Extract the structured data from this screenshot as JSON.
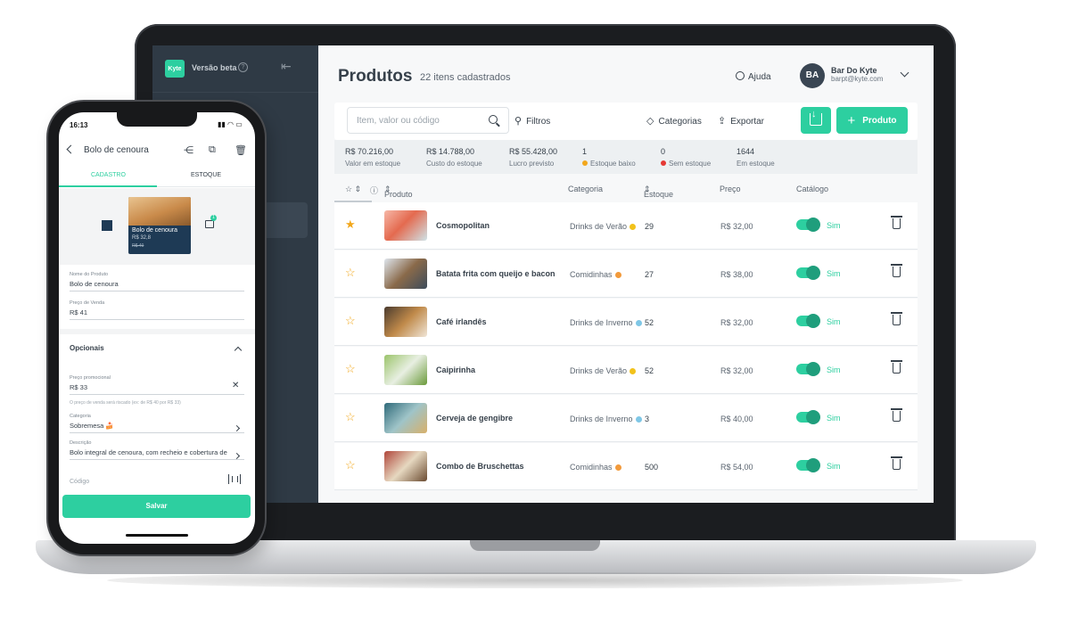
{
  "sidebar": {
    "logo": "Kyte",
    "beta_label": "Versão beta"
  },
  "header": {
    "title": "Produtos",
    "subtitle": "22 itens cadastrados",
    "help": "Ajuda",
    "account": {
      "initials": "BA",
      "name": "Bar Do Kyte",
      "email": "barpt@kyte.com"
    }
  },
  "toolbar": {
    "search_placeholder": "Item, valor ou código",
    "filters": "Filtros",
    "categories": "Categorias",
    "export": "Exportar",
    "add_product": "Produto"
  },
  "stats": [
    {
      "value": "R$ 70.216,00",
      "label": "Valor em estoque"
    },
    {
      "value": "R$ 14.788,00",
      "label": "Custo do estoque"
    },
    {
      "value": "R$ 55.428,00",
      "label": "Lucro previsto"
    },
    {
      "value": "1",
      "label": "Estoque baixo",
      "dot": "#f2a71b"
    },
    {
      "value": "0",
      "label": "Sem estoque",
      "dot": "#e53935"
    },
    {
      "value": "1644",
      "label": "Em estoque"
    }
  ],
  "table": {
    "columns": {
      "product": "Produto",
      "category": "Categoria",
      "stock": "Estoque",
      "price": "Preço",
      "catalog": "Catálogo"
    },
    "rows": [
      {
        "starred": true,
        "name": "Cosmopolitan",
        "category": "Drinks de Verão",
        "cat_dot": "#f2c21b",
        "stock": "29",
        "price": "R$ 32,00",
        "catalog": "Sim",
        "thumb": "linear-gradient(135deg,#f6b8a8,#e46a4f 45%,#cfe3e8)"
      },
      {
        "starred": false,
        "name": "Batata frita com queijo e bacon",
        "category": "Comidinhas",
        "cat_dot": "#f29a3b",
        "stock": "27",
        "price": "R$ 38,00",
        "catalog": "Sim",
        "thumb": "linear-gradient(135deg,#dfe6ee,#8a6a4a 50%,#3d4c5b)"
      },
      {
        "starred": false,
        "name": "Café irlandês",
        "category": "Drinks de Inverno",
        "cat_dot": "#7fc7e6",
        "stock": "52",
        "price": "R$ 32,00",
        "catalog": "Sim",
        "thumb": "linear-gradient(135deg,#4a3b2e,#c08a4a 50%,#f0e6d8)"
      },
      {
        "starred": false,
        "name": "Caipirinha",
        "category": "Drinks de Verão",
        "cat_dot": "#f2c21b",
        "stock": "52",
        "price": "R$ 32,00",
        "catalog": "Sim",
        "thumb": "linear-gradient(135deg,#9bc46a,#e8efe2 50%,#6a9a3a)"
      },
      {
        "starred": false,
        "name": "Cerveja de gengibre",
        "category": "Drinks de Inverno",
        "cat_dot": "#7fc7e6",
        "stock": "3",
        "price": "R$ 40,00",
        "catalog": "Sim",
        "thumb": "linear-gradient(135deg,#2f6a7a,#9fc4c8 50%,#d8b06a)"
      },
      {
        "starred": false,
        "name": "Combo de Bruschettas",
        "category": "Comidinhas",
        "cat_dot": "#f29a3b",
        "stock": "500",
        "price": "R$ 54,00",
        "catalog": "Sim",
        "thumb": "linear-gradient(135deg,#b0463a,#e6d8c0 50%,#6a4a30)"
      }
    ]
  },
  "phone": {
    "time": "16:13",
    "title": "Bolo de cenoura",
    "tabs": [
      "CADASTRO",
      "ESTOQUE"
    ],
    "card": {
      "name": "Bolo de cenoura",
      "price": "R$ 32,8",
      "old_price": "R$ 40"
    },
    "fields": {
      "name_label": "Nome do Produto",
      "name_value": "Bolo de cenoura",
      "price_label": "Preço de Venda",
      "price_value": "R$ 41",
      "optional_title": "Opcionais",
      "promo_label": "Preço promocional",
      "promo_value": "R$ 33",
      "promo_hint": "O preço de venda será riscado (ex: de R$ 40 por R$ 33)",
      "category_label": "Categoria",
      "category_value": "Sobremesa 🍰",
      "description_label": "Descrição",
      "description_value": "Bolo integral de cenoura, com recheio e cobertura de",
      "code_placeholder": "Código"
    },
    "save": "Salvar"
  }
}
